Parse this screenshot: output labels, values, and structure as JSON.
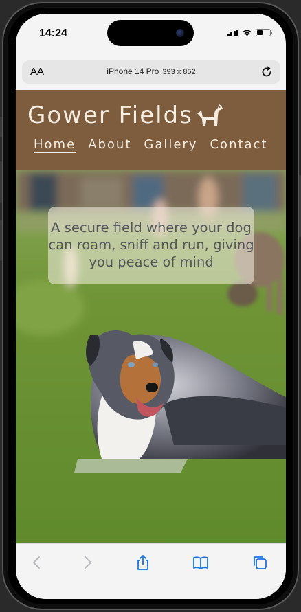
{
  "status_bar": {
    "time": "14:24"
  },
  "browser": {
    "text_size_label": "AA",
    "device_name": "iPhone 14 Pro",
    "device_dimensions": "393 x 852"
  },
  "site": {
    "brand": "Gower Fields",
    "nav": [
      {
        "label": "Home",
        "active": true
      },
      {
        "label": "About",
        "active": false
      },
      {
        "label": "Gallery",
        "active": false
      },
      {
        "label": "Contact",
        "active": false
      }
    ],
    "hero_text": "A secure field where your dog can roam, sniff and run, giving you peace of mind"
  },
  "toolbar": {
    "icons": [
      "back-icon",
      "forward-icon",
      "share-icon",
      "bookmarks-icon",
      "tabs-icon"
    ]
  },
  "colors": {
    "header_bg": "#7e5d3e",
    "header_text": "#f6ede2",
    "accent_blue": "#1a73e8"
  }
}
